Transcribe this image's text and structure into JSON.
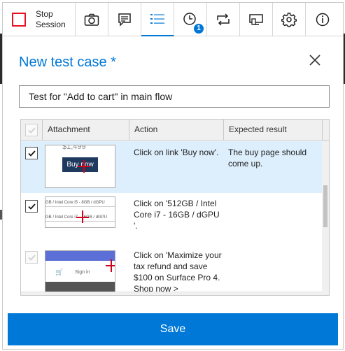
{
  "toolbar": {
    "stop_label": "Stop Session",
    "notes_count": "1",
    "items": [
      {
        "icon": "camera-icon"
      },
      {
        "icon": "note-icon"
      },
      {
        "icon": "list-icon",
        "active": true
      },
      {
        "icon": "clock-icon"
      },
      {
        "icon": "loop-icon"
      },
      {
        "icon": "screen-icon"
      },
      {
        "icon": "gear-icon"
      },
      {
        "icon": "info-icon"
      }
    ]
  },
  "dialog": {
    "title": "New test case *",
    "name_value": "Test for \"Add to cart\" in main flow"
  },
  "grid": {
    "columns": [
      "Attachment",
      "Action",
      "Expected result"
    ],
    "rows": [
      {
        "checked": true,
        "selected": true,
        "thumb": {
          "price": "$1,499",
          "button": "Buy now"
        },
        "action": "Click on link 'Buy now'.",
        "expected": "The buy page should come up."
      },
      {
        "checked": true,
        "selected": false,
        "thumb": {
          "line1": "GB / Intel Core i5 - 8GB / dGPU",
          "line2": "GB / Intel Core i7 - 16GB / dGPU"
        },
        "action": "Click on '512GB / Intel Core i7 - 16GB / dGPU '.",
        "expected": ""
      },
      {
        "checked": false,
        "selected": false,
        "thumb": {
          "signin": "Sign in"
        },
        "action": "Click on 'Maximize your tax refund and save $100 on Surface Pro 4. Shop now >",
        "expected": ""
      }
    ]
  },
  "save_label": "Save",
  "colors": {
    "accent": "#0078d7",
    "stop": "#e81123",
    "selected_row": "#ddeefc"
  }
}
